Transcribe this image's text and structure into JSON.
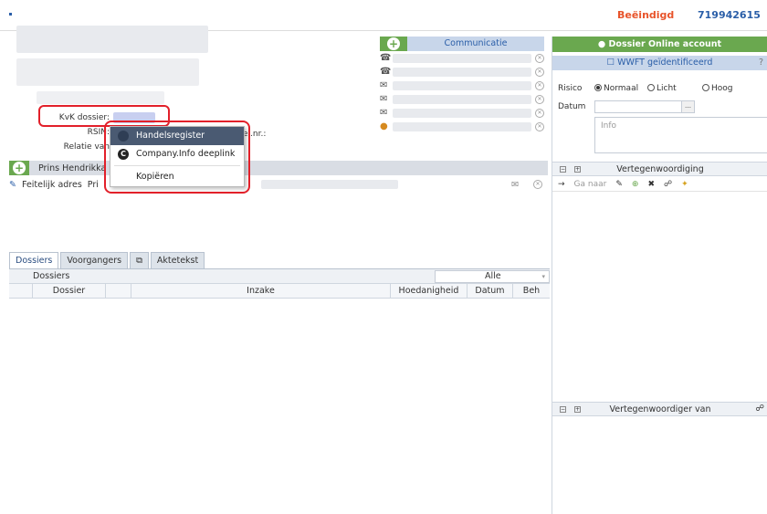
{
  "header": {
    "status": "Beëindigd",
    "dossier_number": "719942615"
  },
  "left_info": {
    "kvk_label": "KvK dossier:",
    "rsin_label": "RSIN:",
    "relatie_label": "Relatie van",
    "partial_text": "el.nr.:"
  },
  "context_menu": {
    "items": [
      {
        "label": "Handelsregister"
      },
      {
        "label": "Company.Info deeplink"
      },
      {
        "label": "Kopiëren"
      }
    ]
  },
  "communication": {
    "title": "Communicatie"
  },
  "address": {
    "header": "Prins Hendrikka",
    "row_label": "Feitelijk adres",
    "row_prefix": "Pri"
  },
  "tabs": [
    {
      "label": "Dossiers"
    },
    {
      "label": "Voorgangers"
    },
    {
      "label": "Aktetekst"
    }
  ],
  "dossiers": {
    "label": "Dossiers",
    "filter": "Alle",
    "columns": [
      "Dossier",
      "Inzake",
      "Hoedanigheid",
      "Datum",
      "Beh"
    ]
  },
  "right_panel": {
    "online_account": "Dossier Online account",
    "wwft": "WWFT geïdentificeerd",
    "risico_label": "Risico",
    "risico_options": [
      "Normaal",
      "Licht",
      "Hoog"
    ],
    "datum_label": "Datum",
    "info_placeholder": "Info",
    "vertegenwoordiging": "Vertegenwoordiging",
    "ga_naar": "Ga naar",
    "vertegenwoordiger_van": "Vertegenwoordiger van"
  },
  "colors": {
    "accent_green": "#6aa84f",
    "status_orange": "#e8542b",
    "link_blue": "#2a5ea8",
    "highlight_red": "#e2202a"
  }
}
